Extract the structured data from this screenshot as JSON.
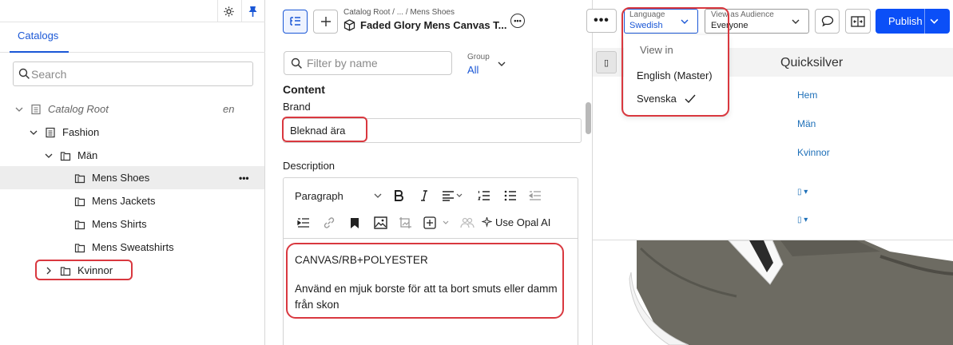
{
  "sidebar": {
    "tab_label": "Catalogs",
    "search_placeholder": "Search",
    "tree": [
      {
        "label": "Catalog Root",
        "lang": "en"
      },
      {
        "label": "Fashion"
      },
      {
        "label": "Män"
      },
      {
        "label": "Mens Shoes"
      },
      {
        "label": "Mens Jackets"
      },
      {
        "label": "Mens Shirts"
      },
      {
        "label": "Mens Sweatshirts"
      },
      {
        "label": "Kvinnor"
      }
    ],
    "row_more": "•••"
  },
  "header": {
    "breadcrumb": "Catalog Root  /  ...  /  Mens Shoes",
    "title": "Faded Glory Mens Canvas T...",
    "title_more": "•••",
    "more_button": "•••",
    "language_label": "Language",
    "language_value": "Swedish",
    "audience_label": "View as Audience",
    "audience_value": "Everyone",
    "publish_label": "Publish"
  },
  "editor": {
    "filter_placeholder": "Filter by name",
    "group_label": "Group",
    "group_value": "All",
    "section_title": "Content",
    "brand_label": "Brand",
    "brand_value": "Bleknad ära",
    "description_label": "Description",
    "paragraph_select": "Paragraph",
    "opal_ai_label": "Use Opal AI",
    "description_line1": "CANVAS/RB+POLYESTER",
    "description_line2": "Använd en mjuk borste för att ta bort smuts eller damm från skon"
  },
  "language_menu": {
    "title": "View in",
    "options": [
      "English (Master)",
      "Svenska"
    ],
    "selected_index": 1
  },
  "preview": {
    "site_name": "Quicksilver",
    "nav": [
      "Hem",
      "Män",
      "Kvinnor"
    ],
    "toggle_glyph": "▯",
    "icon_item": "▯ ▾"
  },
  "colors": {
    "accent": "#1a57d6",
    "publish": "#0b4ff7",
    "highlight": "#d9383f"
  }
}
